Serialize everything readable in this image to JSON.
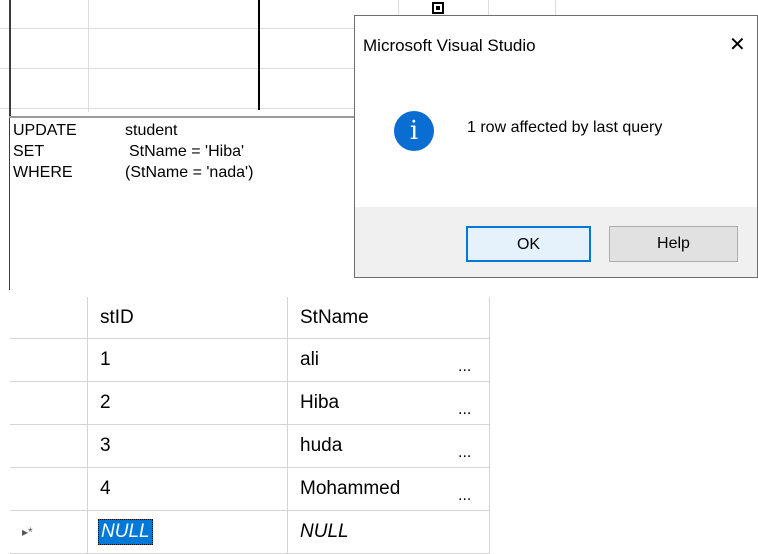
{
  "sql": {
    "line1_kw": "UPDATE",
    "line1_arg": "student",
    "line2_kw": "SET",
    "line2_arg": "StName = 'Hiba'",
    "line3_kw": "WHERE",
    "line3_arg": "(StName = 'nada')"
  },
  "dialog": {
    "title": "Microsoft Visual Studio",
    "close_glyph": "✕",
    "message": "1 row affected by last query",
    "info_glyph": "i",
    "ok_label": "OK",
    "help_label": "Help",
    "colors": {
      "info_icon": "#0a6dd1",
      "ok_border": "#0078d7"
    }
  },
  "results": {
    "columns": [
      "stID",
      "StName"
    ],
    "rows": [
      {
        "stID": "1",
        "StName": "ali",
        "ellipsis": "..."
      },
      {
        "stID": "2",
        "StName": "Hiba",
        "ellipsis": "..."
      },
      {
        "stID": "3",
        "StName": "huda",
        "ellipsis": "..."
      },
      {
        "stID": "4",
        "StName": "Mohammed",
        "ellipsis": "..."
      }
    ],
    "new_row": {
      "marker": "▸*",
      "stID": "NULL",
      "StName": "NULL"
    }
  }
}
